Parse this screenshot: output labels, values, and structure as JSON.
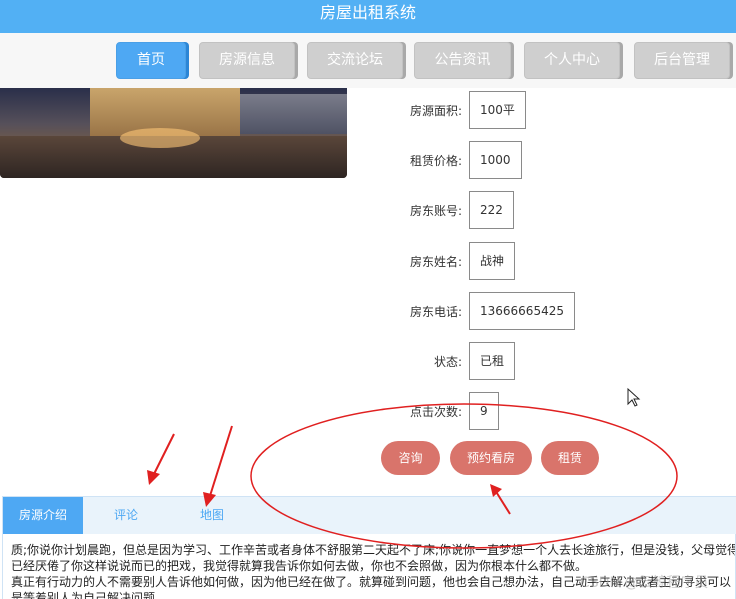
{
  "header": {
    "title": "房屋出租系统"
  },
  "nav": {
    "items": [
      {
        "label": "首页",
        "active": true
      },
      {
        "label": "房源信息",
        "active": false
      },
      {
        "label": "交流论坛",
        "active": false
      },
      {
        "label": "公告资讯",
        "active": false
      },
      {
        "label": "个人中心",
        "active": false
      },
      {
        "label": "后台管理",
        "active": false
      }
    ]
  },
  "details": [
    {
      "label": "房源面积:",
      "value": "100平"
    },
    {
      "label": "租赁价格:",
      "value": "1000"
    },
    {
      "label": "房东账号:",
      "value": "222"
    },
    {
      "label": "房东姓名:",
      "value": "战神"
    },
    {
      "label": "房东电话:",
      "value": "13666665425"
    },
    {
      "label": "状态:",
      "value": "已租"
    },
    {
      "label": "点击次数:",
      "value": "9"
    }
  ],
  "actions": [
    {
      "label": "咨询"
    },
    {
      "label": "预约看房"
    },
    {
      "label": "租赁"
    }
  ],
  "tabs": [
    {
      "label": "房源介绍",
      "active": true
    },
    {
      "label": "评论",
      "active": false
    },
    {
      "label": "地图",
      "active": false
    }
  ],
  "content": {
    "line1": "质;你说你计划晨跑，但总是因为学习、工作辛苦或者身体不舒服第二天起不了床;你说你一直梦想一个人去长途旅行，但是没钱，父母觉得",
    "line2": "已经厌倦了你这样说说而已的把戏，我觉得就算我告诉你如何去做，你也不会照做，因为你根本什么都不做。",
    "line3": "真正有行动力的人不需要别人告诉他如何做，因为他已经在做了。就算碰到问题，他也会自己想办法，自己动手去解决或者主动寻求可以",
    "line4": "是等着别人为自己解决问题。"
  },
  "watermark": "CSDN @云鲸程序员",
  "colors": {
    "header": "#52b0f4",
    "nav_active": "#4ea8f3",
    "action": "#d9746b",
    "annotation": "#e02020"
  }
}
